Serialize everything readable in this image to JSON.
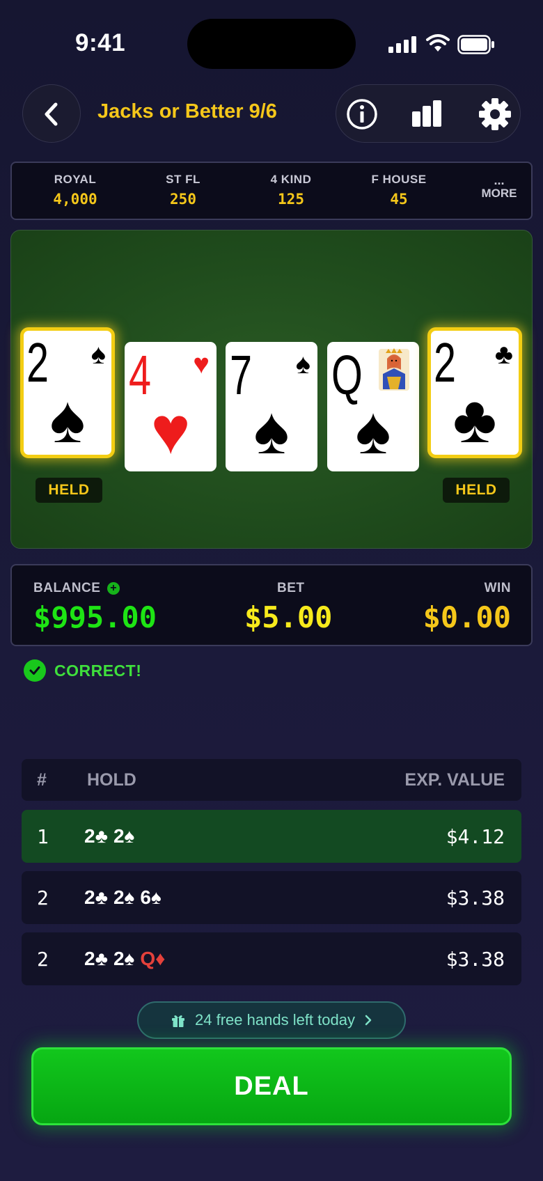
{
  "status": {
    "time": "9:41"
  },
  "header": {
    "title": "Jacks or Better 9/6"
  },
  "paytable": [
    {
      "label": "ROYAL",
      "value": "4,000"
    },
    {
      "label": "ST FL",
      "value": "250"
    },
    {
      "label": "4 KIND",
      "value": "125"
    },
    {
      "label": "F HOUSE",
      "value": "45"
    }
  ],
  "paytable_more": {
    "dots": "...",
    "label": "MORE"
  },
  "cards": [
    {
      "rank": "2",
      "suit": "♠",
      "color": "#000000",
      "held": true
    },
    {
      "rank": "4",
      "suit": "♥",
      "color": "#ee1c1c",
      "held": false
    },
    {
      "rank": "7",
      "suit": "♠",
      "color": "#000000",
      "held": false
    },
    {
      "rank": "Q",
      "suit": "♠",
      "color": "#000000",
      "held": false,
      "face": "queen"
    },
    {
      "rank": "2",
      "suit": "♣",
      "color": "#000000",
      "held": true
    }
  ],
  "held_label": "HELD",
  "balance": {
    "balance_label": "BALANCE",
    "balance_value": "$995.00",
    "bet_label": "BET",
    "bet_value": "$5.00",
    "win_label": "WIN",
    "win_value": "$0.00"
  },
  "feedback": {
    "text": "CORRECT!"
  },
  "strategy": {
    "headers": {
      "num": "#",
      "hold": "HOLD",
      "ev": "EXP. VALUE"
    },
    "rows": [
      {
        "num": "1",
        "hold": [
          {
            "t": "2♣",
            "red": false
          },
          {
            "t": "2♠",
            "red": false
          }
        ],
        "ev": "$4.12"
      },
      {
        "num": "2",
        "hold": [
          {
            "t": "2♣",
            "red": false
          },
          {
            "t": "2♠",
            "red": false
          },
          {
            "t": "6♠",
            "red": false
          }
        ],
        "ev": "$3.38"
      },
      {
        "num": "2",
        "hold": [
          {
            "t": "2♣",
            "red": false
          },
          {
            "t": "2♠",
            "red": false
          },
          {
            "t": "Q♦",
            "red": true
          }
        ],
        "ev": "$3.38"
      }
    ]
  },
  "promo": {
    "text": "24 free hands left today"
  },
  "deal": {
    "label": "DEAL"
  },
  "colors": {
    "accent_gold": "#f5c71a",
    "balance_green": "#1ee414",
    "bet_yellow": "#f7ea1c",
    "win_gold": "#f5c71a",
    "deal_green": "#0cb818"
  }
}
